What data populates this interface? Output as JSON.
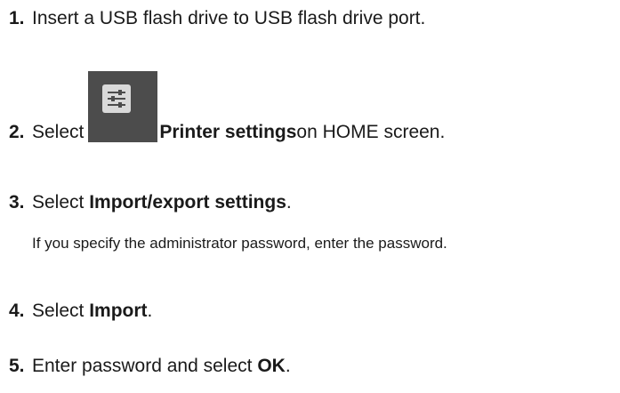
{
  "steps": [
    {
      "num": "1.",
      "text": "Insert a USB flash drive to USB flash drive port."
    },
    {
      "num": "2.",
      "pre": "Select ",
      "bold": "Printer settings",
      "post": " on HOME screen.",
      "icon": "printer-settings-icon"
    },
    {
      "num": "3.",
      "pre": "Select ",
      "bold": "Import/export settings",
      "post": ".",
      "note": "If you specify the administrator password, enter the password."
    },
    {
      "num": "4.",
      "pre": "Select ",
      "bold": "Import",
      "post": "."
    },
    {
      "num": "5.",
      "pre": "Enter password and select ",
      "bold": "OK",
      "post": "."
    }
  ]
}
